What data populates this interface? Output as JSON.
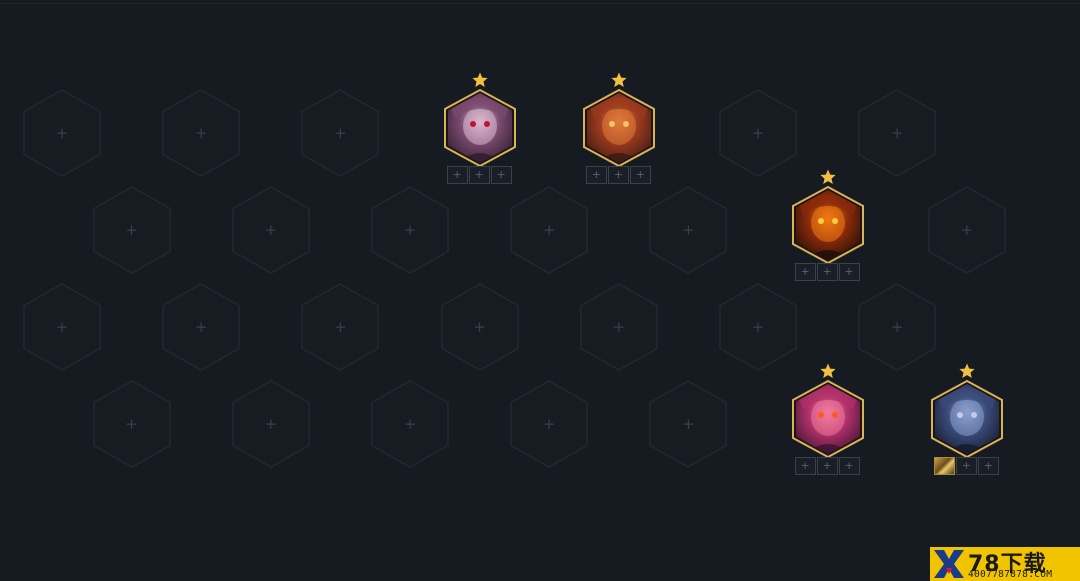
{
  "board": {
    "rows": 4,
    "cols": 7,
    "empty_slot_symbol": "+",
    "champions": [
      {
        "id": "champ-vampire",
        "row": 0,
        "col": 3,
        "stars": 1,
        "items": [
          null,
          null,
          null
        ],
        "palette": [
          "#2c1c2e",
          "#7a4a6e",
          "#d9b8d0",
          "#c8102e"
        ]
      },
      {
        "id": "champ-brawler",
        "row": 0,
        "col": 4,
        "stars": 1,
        "items": [
          null,
          null,
          null
        ],
        "palette": [
          "#3a1a12",
          "#9a3a1e",
          "#e07a3a",
          "#f2c36a"
        ]
      },
      {
        "id": "champ-molten",
        "row": 1,
        "col": 5,
        "stars": 1,
        "items": [
          null,
          null,
          null
        ],
        "palette": [
          "#1e0e08",
          "#8a2a0a",
          "#f07a10",
          "#ffcc44"
        ]
      },
      {
        "id": "champ-jester",
        "row": 3,
        "col": 5,
        "stars": 1,
        "items": [
          null,
          null,
          null
        ],
        "palette": [
          "#3a1430",
          "#b0306a",
          "#f07a9a",
          "#ff5a1e"
        ]
      },
      {
        "id": "champ-knight",
        "row": 3,
        "col": 6,
        "stars": 1,
        "items": [
          "sword-item",
          null,
          null
        ],
        "palette": [
          "#141a2c",
          "#3a4a78",
          "#8aa0d0",
          "#c8c8e8"
        ]
      }
    ]
  },
  "colors": {
    "background": "#161a21",
    "slot_stroke": "#232831",
    "gold": "#d9b25a",
    "star": "#f0c040"
  },
  "watermark": {
    "main": "78下载",
    "sub": "4007787878.COM",
    "logo_icon": "x-logo-icon"
  }
}
